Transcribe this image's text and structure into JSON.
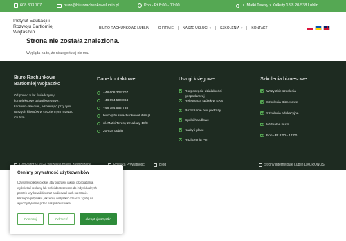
{
  "topbar": {
    "phone": "608 303 707",
    "email": "biuro@biurorachunkowelublin.pl",
    "hours": "Pon - Pt 8:00 - 17:00",
    "address": "ul. Matki Teresy z Kalkuty 18/8 20-538 Lublin"
  },
  "header": {
    "logo": [
      "Instytut Edukacji i",
      "Rozwoju Bartłomiej",
      "Wojtaszko"
    ],
    "nav": [
      {
        "label": "BIURO RACHUNKOWE LUBLIN"
      },
      {
        "label": "O FIRMIE"
      },
      {
        "label": "NASZE USŁUGI",
        "dropdown": true
      },
      {
        "label": "SZKOLENIA",
        "dropdown": true
      },
      {
        "label": "KONTAKT"
      }
    ],
    "languages": [
      "pl",
      "ua",
      "en"
    ]
  },
  "main": {
    "title": "Strona nie została znaleziona.",
    "subtitle": "Wygląda na to, że niczego tutaj nie ma."
  },
  "footer": {
    "about_title": [
      "Biuro Rachunkowe",
      "Bartłomiej Wojtaszko"
    ],
    "about_lines": [
      "Od ponad 5 lat świadczymy",
      "kompleksowe usługi księgowe,",
      "kadrowo-płacowe, wspierając przy tym",
      "naszych klientów w codziennym rozwoju",
      "ich firm."
    ],
    "contact_title": "Dane kontaktowe:",
    "contacts": [
      {
        "icon": "phone-icon",
        "text": "+48 608 303 707"
      },
      {
        "icon": "phone-icon",
        "text": "+48 694 500 084"
      },
      {
        "icon": "phone-icon",
        "text": "+48 784 562 738"
      },
      {
        "icon": "mail-icon",
        "text": "biuro@biurorachunkowelublin.pl"
      },
      {
        "icon": "pin-icon",
        "text": "ul. Matki Teresy z Kalkuty 18/8"
      },
      {
        "icon": "building-icon",
        "text": "20-538 Lublin"
      }
    ],
    "services_title": "Usługi księgowe:",
    "services": [
      "Rozpoczęcie działalności gospodarczej",
      "Rejestracja spółek w KRS",
      "Rozliczanie biur podróży",
      "Spółki handlowe",
      "Kadry i płace",
      "Rozliczenia PIT"
    ],
    "trainings_title": "Szkolenia biznesowe:",
    "trainings": [
      "Wszystkie szkolenia",
      "Szkolenia Biznesowe",
      "Szkolenie edukacyjne",
      "Wirtualne biuro",
      "Pon - Pt 8:00 - 17:00"
    ],
    "bottom": {
      "copyright": "Copyright © 2024 Wszelkie prawa zastrzeżone",
      "privacy": "Polityka Prywatności",
      "blog": "Blog",
      "credits": "Strony internetowe Lublin DXCRONOS"
    }
  },
  "cookie": {
    "title": "Cenimy prywatność użytkowników",
    "lines": [
      "Używamy plików cookie, aby poprawić jakość przeglądania,",
      "wyświetlać reklamy lub treści dostosowane do indywidualnych",
      "potrzeb użytkowników oraz analizować ruch na stronie.",
      "Kliknięcie przycisku „Akceptuj wszystko” oznacza zgodę na",
      "wykorzystywanie przez nas plików cookie."
    ],
    "customize": "Dostosuj",
    "reject": "Odrzucić",
    "accept": "Akceptuj wszystko"
  },
  "colors": {
    "accent": "#55a853",
    "footer_bg": "#1e2b21",
    "accept_bg": "#2e8b3a"
  }
}
